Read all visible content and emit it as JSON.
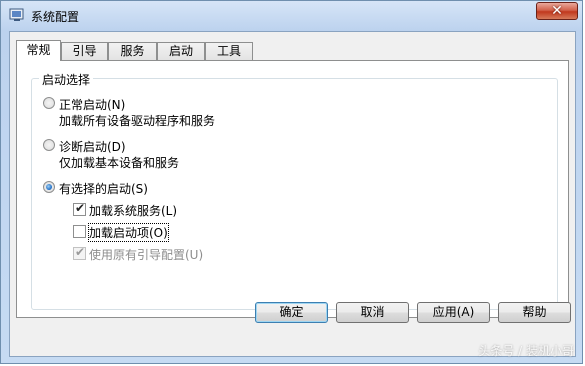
{
  "window": {
    "title": "系统配置",
    "close_glyph": "✕",
    "icon": "system-config-icon"
  },
  "tabs": [
    {
      "label": "常规",
      "active": true
    },
    {
      "label": "引导",
      "active": false
    },
    {
      "label": "服务",
      "active": false
    },
    {
      "label": "启动",
      "active": false
    },
    {
      "label": "工具",
      "active": false
    }
  ],
  "startup_selection": {
    "legend": "启动选择",
    "options": [
      {
        "label": "正常启动(N)",
        "description": "加载所有设备驱动程序和服务",
        "selected": false
      },
      {
        "label": "诊断启动(D)",
        "description": "仅加载基本设备和服务",
        "selected": false
      },
      {
        "label": "有选择的启动(S)",
        "selected": true
      }
    ],
    "selective_items": [
      {
        "label": "加载系统服务(L)",
        "checked": true,
        "enabled": true
      },
      {
        "label": "加载启动项(O)",
        "checked": false,
        "enabled": true
      },
      {
        "label": "使用原有引导配置(U)",
        "checked": true,
        "enabled": false
      }
    ]
  },
  "buttons": {
    "ok": "确定",
    "cancel": "取消",
    "apply": "应用(A)",
    "help": "帮助"
  },
  "watermark": "头条号 / 装机小哥",
  "colors": {
    "title_gradient_top": "#d6e5f7",
    "selected_radio": "#1a69c4",
    "close_button": "#c1381e"
  }
}
